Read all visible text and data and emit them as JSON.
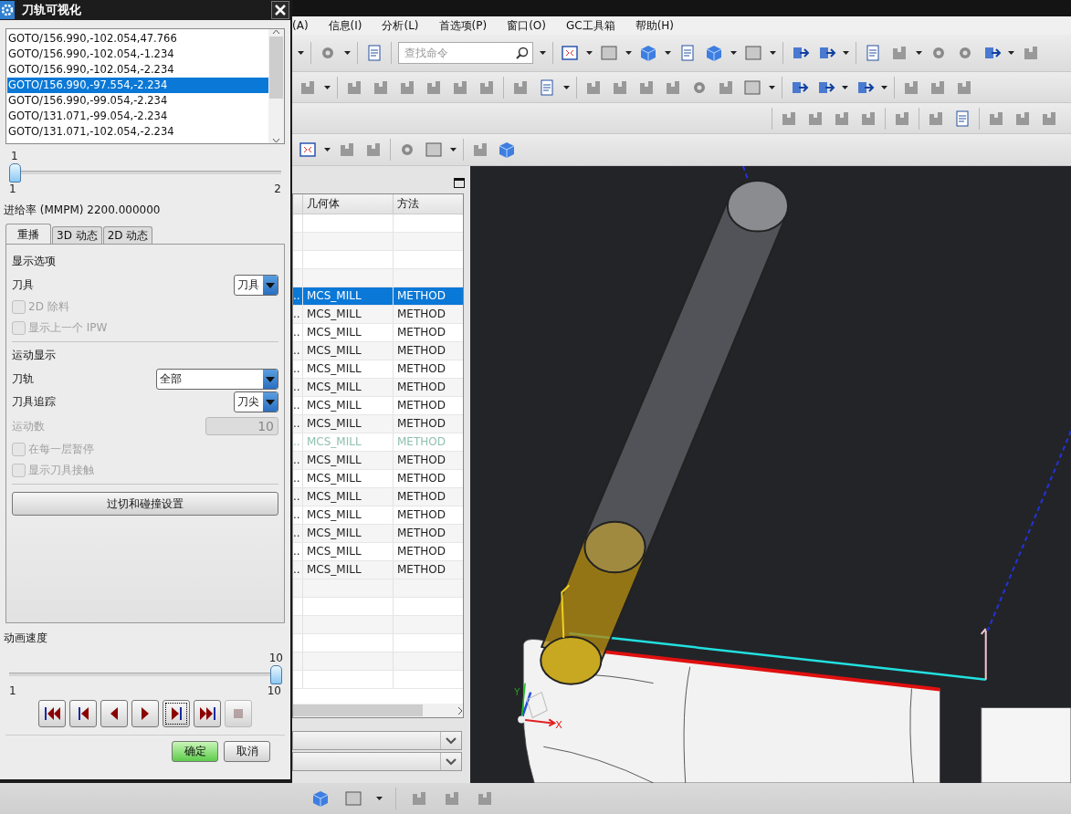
{
  "dialog": {
    "title": "刀轨可视化",
    "motion_list": [
      {
        "text": "GOTO/156.990,-102.054,47.766",
        "selected": false
      },
      {
        "text": "GOTO/156.990,-102.054,-1.234",
        "selected": false
      },
      {
        "text": "GOTO/156.990,-102.054,-2.234",
        "selected": false
      },
      {
        "text": "GOTO/156.990,-97.554,-2.234",
        "selected": true
      },
      {
        "text": "GOTO/156.990,-99.054,-2.234",
        "selected": false
      },
      {
        "text": "GOTO/131.071,-99.054,-2.234",
        "selected": false
      },
      {
        "text": "GOTO/131.071,-102.054,-2.234",
        "selected": false
      }
    ],
    "motion_slider": {
      "value": "1",
      "min": "1",
      "max": "2",
      "level": 0
    },
    "feed_rate": "进给率 (MMPM) 2200.000000",
    "tabs": [
      {
        "label": "重播",
        "selected": true
      },
      {
        "label": "3D 动态",
        "selected": false
      },
      {
        "label": "2D 动态",
        "selected": false
      }
    ],
    "sections": [
      {
        "title": "显示选项",
        "items": [
          {
            "kind": "select",
            "label": "刀具",
            "value": "刀具"
          },
          {
            "kind": "checkbox",
            "label": "2D 除料",
            "checked": false,
            "disabled": true
          },
          {
            "kind": "checkbox",
            "label": "显示上一个 IPW",
            "checked": false,
            "disabled": true
          }
        ]
      },
      {
        "title": "运动显示",
        "items": [
          {
            "kind": "wideselect",
            "label": "刀轨",
            "value": "全部"
          },
          {
            "kind": "select",
            "label": "刀具追踪",
            "value": "刀尖"
          },
          {
            "kind": "number",
            "label": "运动数",
            "value": "10",
            "disabled": true
          },
          {
            "kind": "checkbox",
            "label": "在每一层暂停",
            "checked": false,
            "disabled": true
          },
          {
            "kind": "checkbox",
            "label": "显示刀具接触",
            "checked": false,
            "disabled": true
          }
        ]
      }
    ],
    "settings_button": "过切和碰撞设置",
    "speed": {
      "label": "动画速度",
      "value": "10",
      "min": "1",
      "max": "10",
      "level": 1
    },
    "playback": [
      {
        "kind": "to-start",
        "focused": false,
        "disabled": false
      },
      {
        "kind": "prev-op",
        "focused": false,
        "disabled": false
      },
      {
        "kind": "reverse",
        "focused": false,
        "disabled": false
      },
      {
        "kind": "play",
        "focused": false,
        "disabled": false
      },
      {
        "kind": "next-op",
        "focused": true,
        "disabled": false
      },
      {
        "kind": "to-end",
        "focused": false,
        "disabled": false
      },
      {
        "kind": "stop",
        "focused": false,
        "disabled": true
      }
    ],
    "buttons": [
      {
        "label": "确定",
        "primary": true
      },
      {
        "label": "取消",
        "primary": false
      }
    ]
  },
  "menu": [
    "(A)",
    "信息(I)",
    "分析(L)",
    "首选项(P)",
    "窗口(O)",
    "GC工具箱",
    "帮助(H)"
  ],
  "search": {
    "placeholder": "查找命令"
  },
  "navigator": {
    "columns": [
      "几何体",
      "方法"
    ],
    "rows": [
      {
        "column_1": "..",
        "geometry": "MCS_MILL",
        "method": "METHOD",
        "selected": true,
        "inactive": false
      },
      {
        "column_1": "..",
        "geometry": "MCS_MILL",
        "method": "METHOD",
        "selected": false,
        "inactive": false
      },
      {
        "column_1": "..",
        "geometry": "MCS_MILL",
        "method": "METHOD",
        "selected": false,
        "inactive": false
      },
      {
        "column_1": "..",
        "geometry": "MCS_MILL",
        "method": "METHOD",
        "selected": false,
        "inactive": false
      },
      {
        "column_1": "..",
        "geometry": "MCS_MILL",
        "method": "METHOD",
        "selected": false,
        "inactive": false
      },
      {
        "column_1": "..",
        "geometry": "MCS_MILL",
        "method": "METHOD",
        "selected": false,
        "inactive": false
      },
      {
        "column_1": "..",
        "geometry": "MCS_MILL",
        "method": "METHOD",
        "selected": false,
        "inactive": false
      },
      {
        "column_1": "..",
        "geometry": "MCS_MILL",
        "method": "METHOD",
        "selected": false,
        "inactive": false
      },
      {
        "column_1": "..",
        "geometry": "MCS_MILL",
        "method": "METHOD",
        "selected": false,
        "inactive": true
      },
      {
        "column_1": "..",
        "geometry": "MCS_MILL",
        "method": "METHOD",
        "selected": false,
        "inactive": false
      },
      {
        "column_1": "..",
        "geometry": "MCS_MILL",
        "method": "METHOD",
        "selected": false,
        "inactive": false
      },
      {
        "column_1": "..",
        "geometry": "MCS_MILL",
        "method": "METHOD",
        "selected": false,
        "inactive": false
      },
      {
        "column_1": "..",
        "geometry": "MCS_MILL",
        "method": "METHOD",
        "selected": false,
        "inactive": false
      },
      {
        "column_1": "..",
        "geometry": "MCS_MILL",
        "method": "METHOD",
        "selected": false,
        "inactive": false
      },
      {
        "column_1": "..",
        "geometry": "MCS_MILL",
        "method": "METHOD",
        "selected": false,
        "inactive": false
      },
      {
        "column_1": "..",
        "geometry": "MCS_MILL",
        "method": "METHOD",
        "selected": false,
        "inactive": false
      }
    ]
  },
  "viewport": {
    "axis_labels": [
      "Y",
      "X"
    ]
  }
}
